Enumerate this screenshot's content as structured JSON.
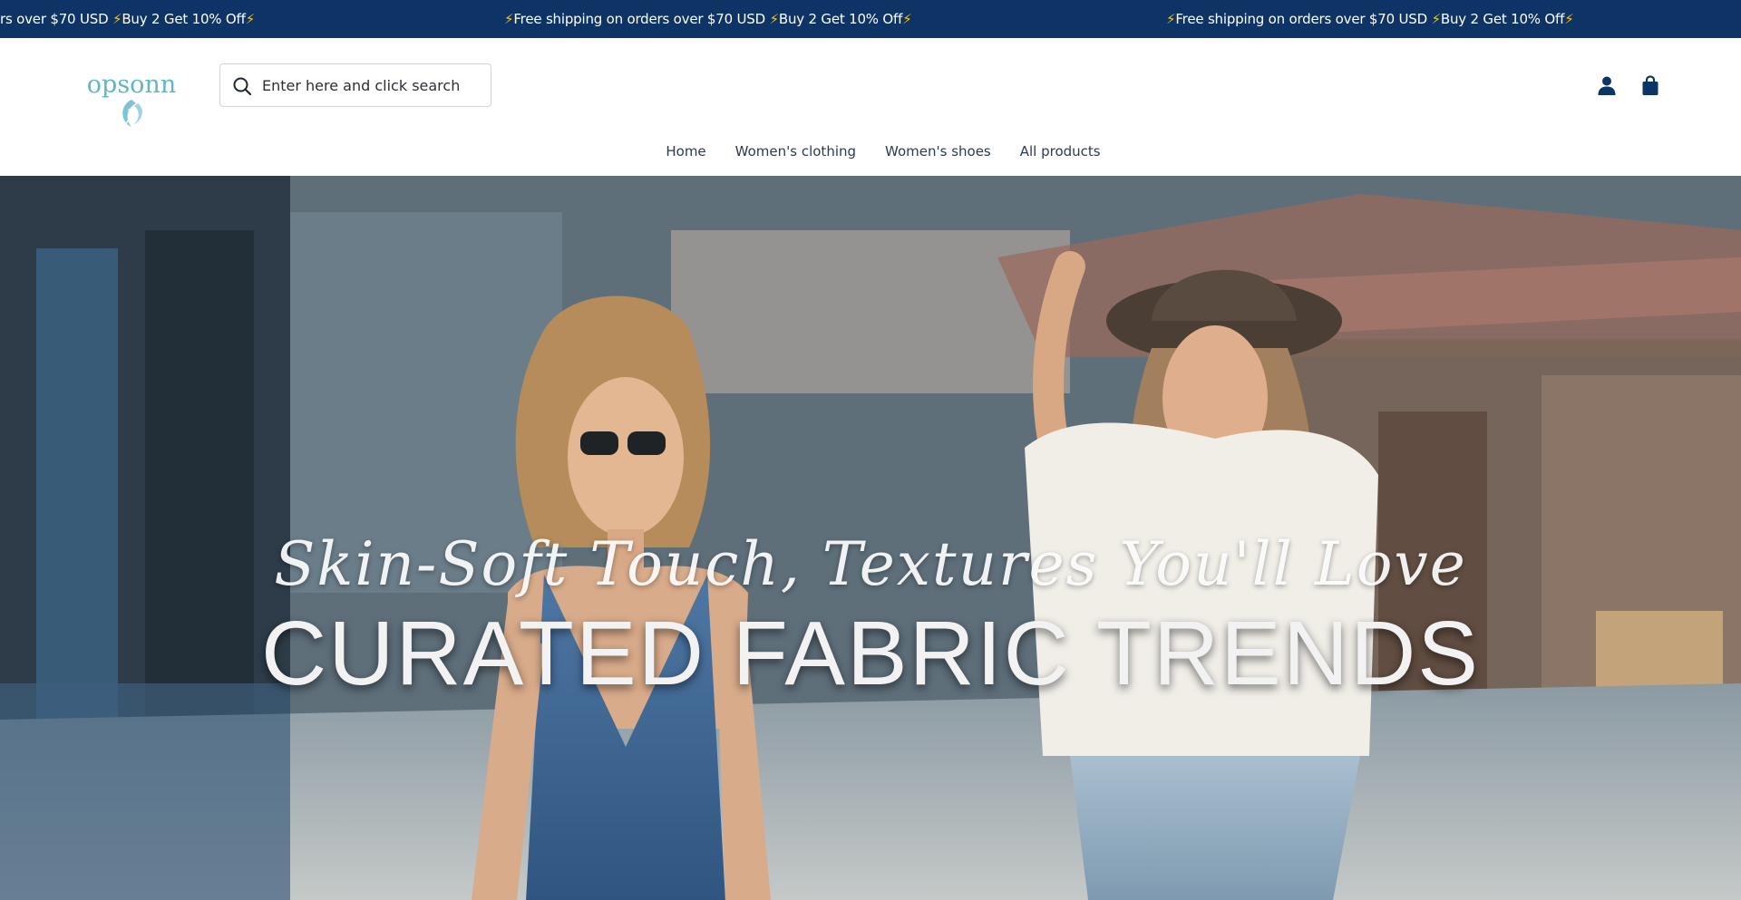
{
  "announcement": {
    "items": [
      {
        "text": "rs over $70 USD ",
        "suffix": "Buy 2 Get 10% Off"
      },
      {
        "text": "Free shipping on orders over $70 USD ",
        "suffix": "Buy 2 Get 10% Off"
      },
      {
        "text": "Free shipping on orders over $70 USD ",
        "suffix": "Buy 2 Get 10% Off"
      }
    ]
  },
  "header": {
    "logo_text": "opsonn",
    "search": {
      "placeholder": "Enter here and click search"
    },
    "icons": [
      "account-icon",
      "shopping-bag-icon"
    ]
  },
  "nav": {
    "items": [
      {
        "label": "Home"
      },
      {
        "label": "Women's clothing"
      },
      {
        "label": "Women's shoes"
      },
      {
        "label": "All products"
      }
    ]
  },
  "hero": {
    "script_text": "Skin-Soft Touch, Textures You'll Love",
    "title": "CURATED FABRIC TRENDS"
  },
  "colors": {
    "announcement_bg": "#0e3466",
    "brand_teal": "#5fb6c9",
    "icon_navy": "#0e3466",
    "nav_text": "#2b3a55"
  }
}
